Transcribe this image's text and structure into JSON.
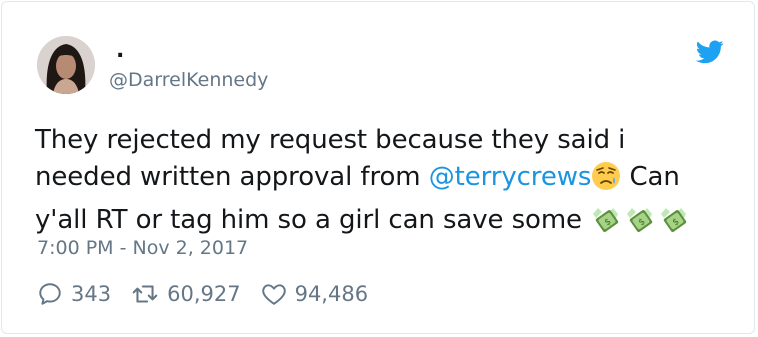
{
  "author": {
    "display_name": ".",
    "handle": "@DarrelKennedy",
    "avatar_icon": "user-avatar"
  },
  "tweet": {
    "line1": "They rejected my request because they said i",
    "line2_before": "needed written approval from ",
    "line2_mention": "@terrycrews",
    "line2_after": " Can",
    "line3": "y'all RT or tag him so a girl can save some ",
    "emoji_sad": "disappointed-relieved-face-emoji",
    "emoji_money": "money-with-wings-emoji"
  },
  "timestamp": "7:00 PM - Nov 2, 2017",
  "actions": {
    "replies": "343",
    "retweets": "60,927",
    "likes": "94,486"
  },
  "colors": {
    "brand": "#1da1f2",
    "mention": "#1b95e0",
    "muted": "#657786",
    "text": "#14171a"
  }
}
